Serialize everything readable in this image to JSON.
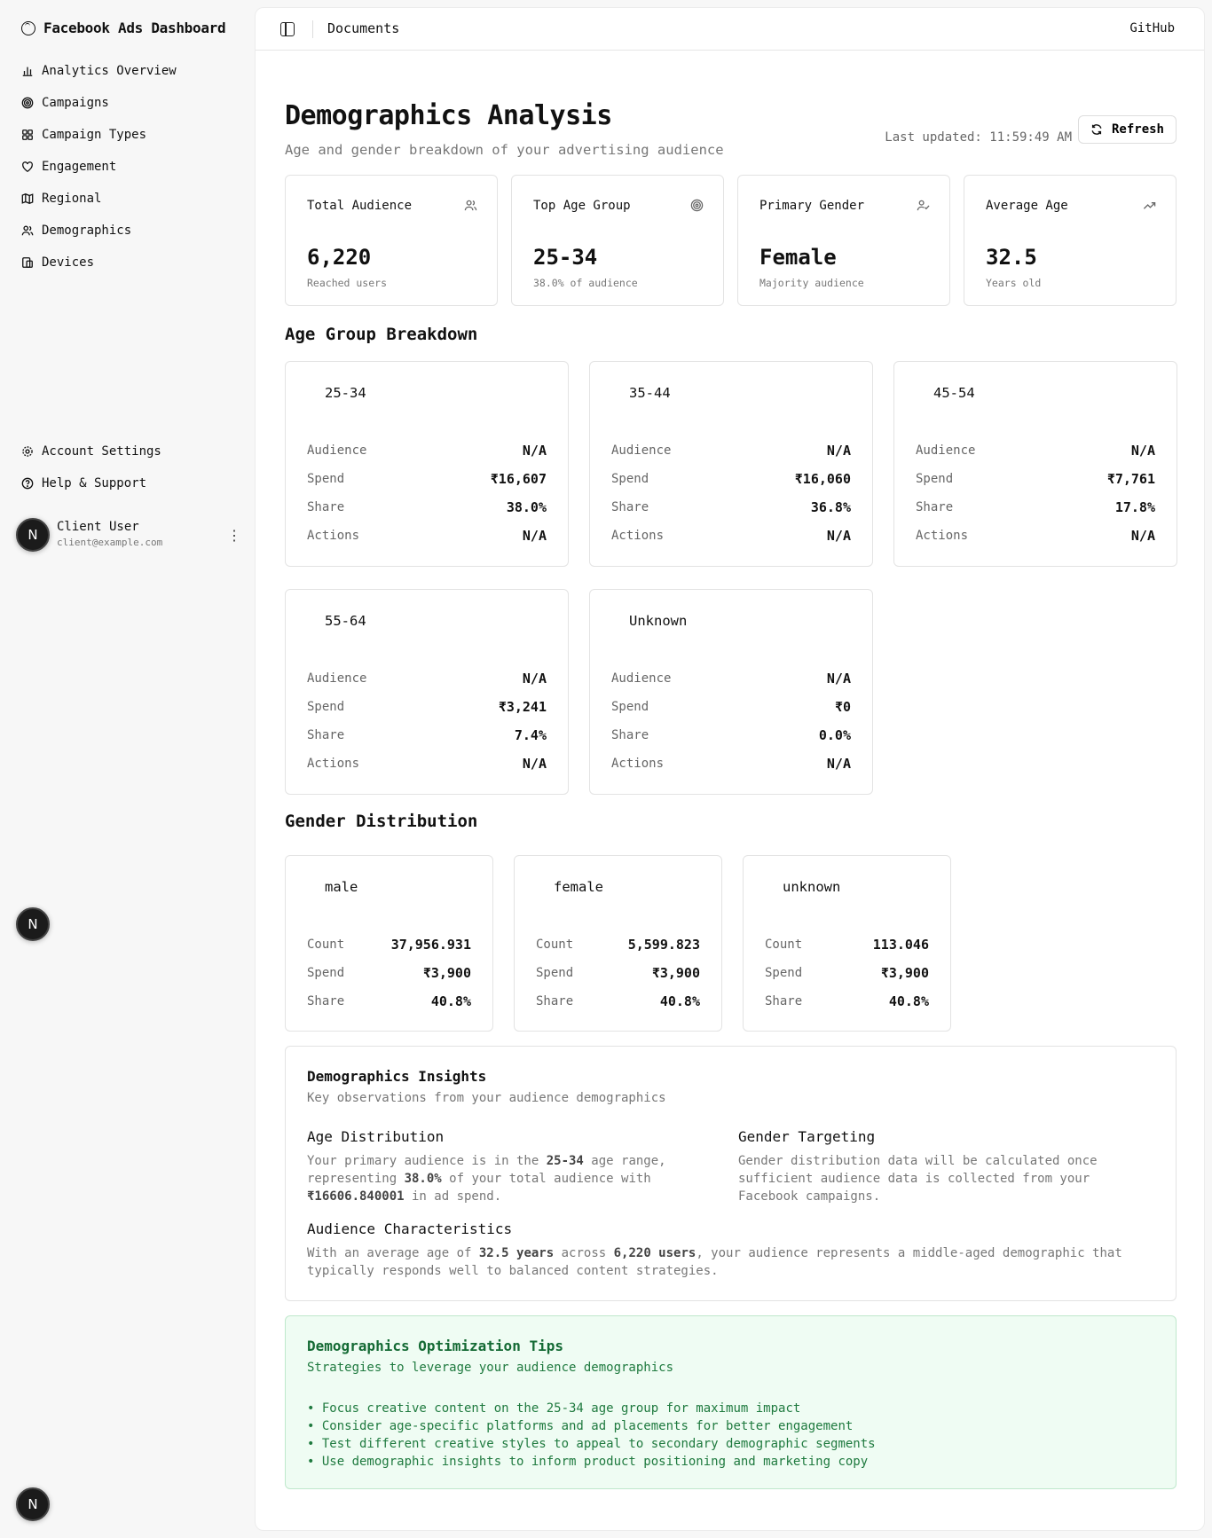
{
  "sidebar": {
    "brand": "Facebook Ads Dashboard",
    "nav": [
      {
        "label": "Analytics Overview",
        "icon": "bar-chart-icon"
      },
      {
        "label": "Campaigns",
        "icon": "target-icon"
      },
      {
        "label": "Campaign Types",
        "icon": "grid-icon"
      },
      {
        "label": "Engagement",
        "icon": "heart-icon"
      },
      {
        "label": "Regional",
        "icon": "map-icon"
      },
      {
        "label": "Demographics",
        "icon": "users-icon"
      },
      {
        "label": "Devices",
        "icon": "devices-icon"
      }
    ],
    "bottom_nav": [
      {
        "label": "Account Settings",
        "icon": "gear-icon"
      },
      {
        "label": "Help & Support",
        "icon": "help-circle-icon"
      }
    ],
    "user": {
      "name": "Client User",
      "email": "client@example.com",
      "avatar_letter": "N"
    },
    "floating_avatar_letter": "N"
  },
  "topbar": {
    "breadcrumb": "Documents",
    "github": "GitHub"
  },
  "header": {
    "title": "Demographics Analysis",
    "subtitle": "Age and gender breakdown of your advertising audience",
    "last_updated": "Last updated: 11:59:49 AM",
    "refresh_label": "Refresh"
  },
  "stats": [
    {
      "label": "Total Audience",
      "value": "6,220",
      "hint": "Reached users",
      "icon": "users-icon"
    },
    {
      "label": "Top Age Group",
      "value": "25-34",
      "hint": "38.0% of audience",
      "icon": "target-icon"
    },
    {
      "label": "Primary Gender",
      "value": "Female",
      "hint": "Majority audience",
      "icon": "user-check-icon"
    },
    {
      "label": "Average Age",
      "value": "32.5",
      "hint": "Years old",
      "icon": "trending-up-icon"
    }
  ],
  "age_section_title": "Age Group Breakdown",
  "age_groups": [
    {
      "name": "25-34",
      "rows": [
        {
          "k": "Audience",
          "v": "N/A"
        },
        {
          "k": "Spend",
          "v": "₹16,607"
        },
        {
          "k": "Share",
          "v": "38.0%"
        },
        {
          "k": "Actions",
          "v": "N/A"
        }
      ]
    },
    {
      "name": "35-44",
      "rows": [
        {
          "k": "Audience",
          "v": "N/A"
        },
        {
          "k": "Spend",
          "v": "₹16,060"
        },
        {
          "k": "Share",
          "v": "36.8%"
        },
        {
          "k": "Actions",
          "v": "N/A"
        }
      ]
    },
    {
      "name": "45-54",
      "rows": [
        {
          "k": "Audience",
          "v": "N/A"
        },
        {
          "k": "Spend",
          "v": "₹7,761"
        },
        {
          "k": "Share",
          "v": "17.8%"
        },
        {
          "k": "Actions",
          "v": "N/A"
        }
      ]
    },
    {
      "name": "55-64",
      "rows": [
        {
          "k": "Audience",
          "v": "N/A"
        },
        {
          "k": "Spend",
          "v": "₹3,241"
        },
        {
          "k": "Share",
          "v": "7.4%"
        },
        {
          "k": "Actions",
          "v": "N/A"
        }
      ]
    },
    {
      "name": "Unknown",
      "rows": [
        {
          "k": "Audience",
          "v": "N/A"
        },
        {
          "k": "Spend",
          "v": "₹0"
        },
        {
          "k": "Share",
          "v": "0.0%"
        },
        {
          "k": "Actions",
          "v": "N/A"
        }
      ]
    }
  ],
  "gender_section_title": "Gender Distribution",
  "genders": [
    {
      "name": "male",
      "rows": [
        {
          "k": "Count",
          "v": "37,956.931"
        },
        {
          "k": "Spend",
          "v": "₹3,900"
        },
        {
          "k": "Share",
          "v": "40.8%"
        }
      ]
    },
    {
      "name": "female",
      "rows": [
        {
          "k": "Count",
          "v": "5,599.823"
        },
        {
          "k": "Spend",
          "v": "₹3,900"
        },
        {
          "k": "Share",
          "v": "40.8%"
        }
      ]
    },
    {
      "name": "unknown",
      "rows": [
        {
          "k": "Count",
          "v": "113.046"
        },
        {
          "k": "Spend",
          "v": "₹3,900"
        },
        {
          "k": "Share",
          "v": "40.8%"
        }
      ]
    }
  ],
  "insights": {
    "title": "Demographics Insights",
    "subtitle": "Key observations from your audience demographics",
    "age_title": "Age Distribution",
    "age_text": [
      "Your primary audience is in the ",
      "25-34",
      " age range, representing ",
      "38.0%",
      " of your total audience with ",
      "₹16606.840001",
      " in ad spend."
    ],
    "gender_title": "Gender Targeting",
    "gender_text": "Gender distribution data will be calculated once sufficient audience data is collected from your Facebook campaigns.",
    "audience_title": "Audience Characteristics",
    "audience_text": [
      "With an average age of ",
      "32.5 years",
      " across ",
      "6,220 users",
      ", your audience represents a middle-aged demographic that typically responds well to balanced content strategies."
    ]
  },
  "tips": {
    "title": "Demographics Optimization Tips",
    "subtitle": "Strategies to leverage your audience demographics",
    "items": [
      "Focus creative content on the 25-34 age group for maximum impact",
      "Consider age-specific platforms and ad placements for better engagement",
      "Test different creative styles to appeal to secondary demographic segments",
      "Use demographic insights to inform product positioning and marketing copy"
    ]
  },
  "colors": {
    "tips_bg": "#effcf3",
    "tips_text": "#1f7a3f",
    "avatar_bg": "#1b1b1b"
  }
}
